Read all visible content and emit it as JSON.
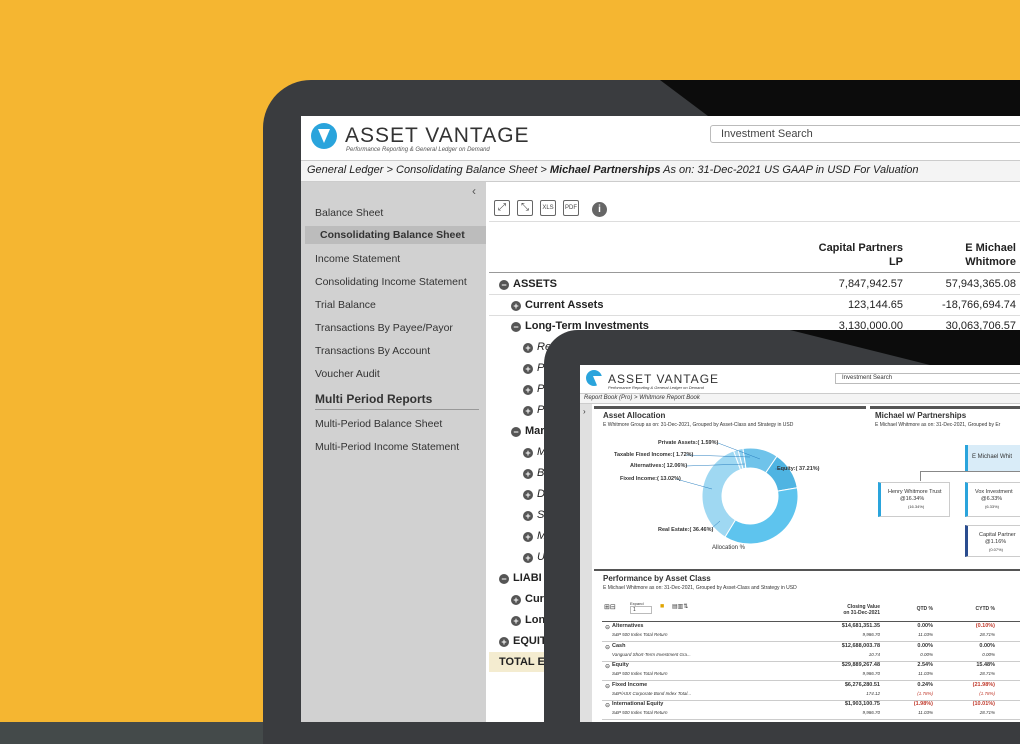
{
  "brand": {
    "name": "ASSET VANTAGE",
    "tagline": "Performance Reporting & General Ledger on Demand"
  },
  "search": {
    "placeholder": "Investment Search"
  },
  "breadcrumb": {
    "part1": "General Ledger",
    "sep": ">",
    "part2": "Consolidating Balance Sheet",
    "part3": "Michael Partnerships",
    "suffix": "As on: 31-Dec-2021 US GAAP in USD For Valuation"
  },
  "sidebar": {
    "items": [
      "Balance Sheet",
      "Consolidating Balance Sheet",
      "Income Statement",
      "Consolidating Income Statement",
      "Trial Balance",
      "Transactions By Payee/Payor",
      "Transactions By Account",
      "Voucher Audit"
    ],
    "section": "Multi Period Reports",
    "multi": [
      "Multi-Period Balance Sheet",
      "Multi-Period Income Statement"
    ],
    "collapse": "‹"
  },
  "toolbar": {
    "expand": "⤢",
    "collapse": "⤡",
    "xls": "XLS",
    "pdf": "PDF",
    "info": "i"
  },
  "columns": {
    "c1a": "Capital Partners",
    "c1b": "LP",
    "c2a": "E Michael",
    "c2b": "Whitmore"
  },
  "rows": [
    {
      "label": "ASSETS",
      "v1": "7,847,942.57",
      "v2": "57,943,365.08"
    },
    {
      "label": "Current Assets",
      "v1": "123,144.65",
      "v2": "-18,766,694.74"
    },
    {
      "label": "Long-Term Investments",
      "v1": "3,130,000.00",
      "v2": "30,063,706.57"
    }
  ],
  "partial": {
    "r1": "Re",
    "r2": "P",
    "r3": "P",
    "r4": "P",
    "mar": "Mar",
    "m1": "M",
    "m2": "B",
    "m3": "D",
    "m4": "S",
    "m5": "M",
    "m6": "U",
    "liab": "LIABI",
    "cur": "Curr",
    "long": "Long",
    "equity": "EQUIT",
    "total": "TOTAL EQ"
  },
  "tablet": {
    "brand": "ASSET VANTAGE",
    "tagline": "Performance Reporting & General Ledger on Demand",
    "search": "Investment Search",
    "crumb": "Report Book (Pro)  >  Whitmore Report Book",
    "alloc": {
      "title": "Asset Allocation",
      "sub": "E Whitmore Group as on: 31-Dec-2021, Grouped by Asset-Class and Strategy in USD",
      "caption": "Allocation %",
      "labels": [
        "Private Assets:( 1.59%)",
        "Taxable Fixed Income:( 1.72%)",
        "Alternatives:( 12.06%)",
        "Fixed Income:( 13.02%)",
        "Equity:( 37.21%)",
        "Real Estate:( 36.46%)"
      ]
    },
    "org": {
      "title": "Michael w/ Partnerships",
      "sub": "E Michael Whitmore as on: 31-Dec-2021, Grouped by Er",
      "n1": "E Michael Whit",
      "n2a": "Henry Whitmore Trust",
      "n2b": "@16.34%",
      "n2c": "(16.34%)",
      "n3a": "Vox Investment",
      "n3b": "@6.33%",
      "n3c": "(6.33%)",
      "n4a": "Capital Partner",
      "n4b": "@1.16%",
      "n4c": "(0.07%)"
    },
    "perf": {
      "title": "Performance by Asset Class",
      "sub": "E Michael Whitmore as on: 31-Dec-2021, Grouped by Asset-Class and Strategy in USD",
      "expand": "Expand",
      "expand_val": "1",
      "h1": "Closing Value",
      "h1b": "on 31-Dec-2021",
      "h2": "QTD %",
      "h3": "CYTD %",
      "rows": [
        {
          "name": "Alternatives",
          "v": "$14,681,351.35",
          "q": "0.00%",
          "c": "(0.10%)",
          "bench": "S&P 500 Index Total Return",
          "bv": "9,986.70",
          "bq": "11.03%",
          "bc": "28.71%"
        },
        {
          "name": "Cash",
          "v": "$12,688,003.78",
          "q": "0.00%",
          "c": "0.00%",
          "bench": "Vanguard Short-Term Investment Gra...",
          "bv": "10.74",
          "bq": "0.00%",
          "bc": "0.00%"
        },
        {
          "name": "Equity",
          "v": "$29,889,267.48",
          "q": "2.54%",
          "c": "15.48%",
          "bench": "S&P 500 Index Total Return",
          "bv": "9,986.70",
          "bq": "11.03%",
          "bc": "28.71%"
        },
        {
          "name": "Fixed Income",
          "v": "$6,276,280.51",
          "q": "0.24%",
          "c": "(21.98%)",
          "bench": "S&P/ASX Corporate Bond Index Total...",
          "bv": "174.12",
          "bq": "(1.78%)",
          "bc": "(1.78%)"
        },
        {
          "name": "International Equity",
          "v": "$1,903,100.75",
          "q": "(1.98%)",
          "c": "(10.01%)",
          "bench": "S&P 500 Index Total Return",
          "bv": "9,986.70",
          "bq": "11.03%",
          "bc": "28.71%"
        }
      ]
    }
  },
  "colors": {
    "background": "#f5b631",
    "bezel": "#3a3c3f",
    "brand_blue": "#2aa4dc",
    "negative": "#c0392b"
  },
  "donut": [
    1.59,
    1.72,
    12.06,
    13.02,
    37.21,
    36.46
  ]
}
